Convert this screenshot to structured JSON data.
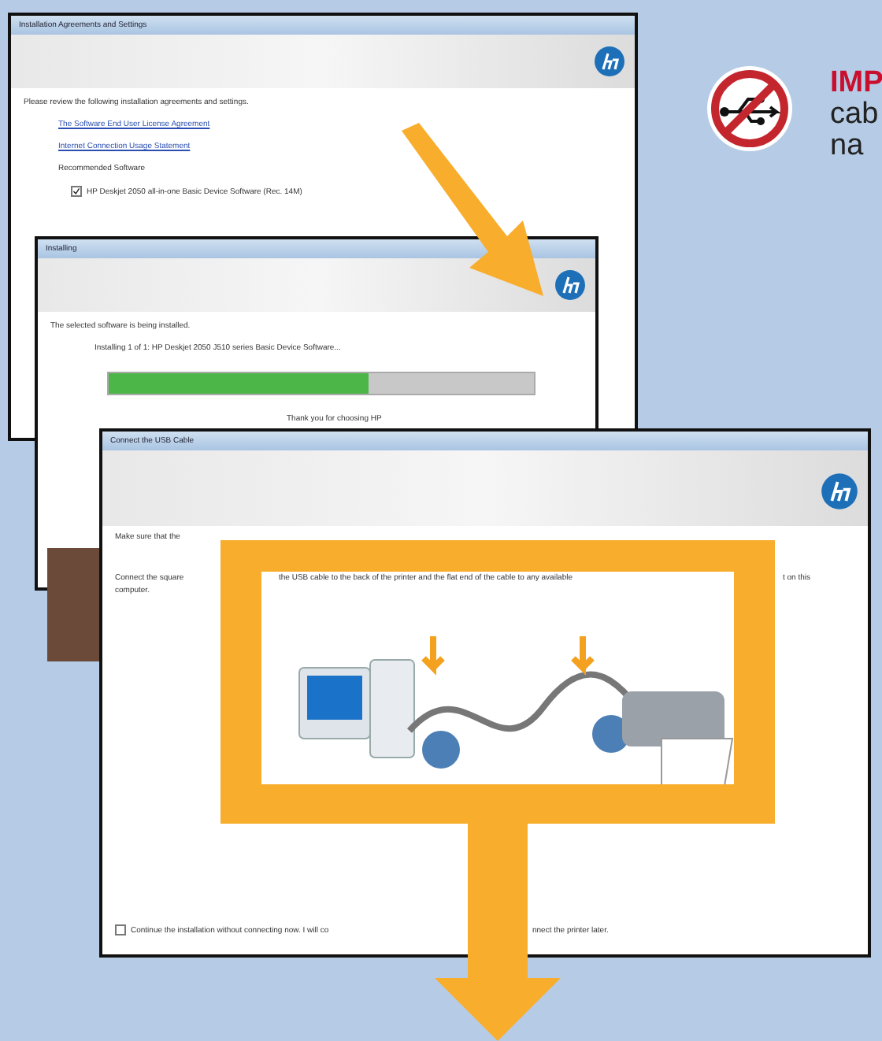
{
  "agreements_window": {
    "title": "Installation Agreements and Settings",
    "intro": "Please review the following installation agreements and settings.",
    "links": [
      "The Software End User License Agreement",
      "Internet Connection Usage Statement"
    ],
    "section": "Recommended Software",
    "software_item": {
      "label": "HP Deskjet 2050 all-in-one Basic Device Software (Rec. 14M)",
      "checked": true
    }
  },
  "installing_window": {
    "title": "Installing",
    "status": "The selected software is being installed.",
    "step": "Installing 1 of 1: HP Deskjet 2050 J510 series Basic Device Software...",
    "progress": {
      "level": 0.61
    },
    "thanks": "Thank you for choosing HP"
  },
  "usb_window": {
    "title": "Connect the USB Cable",
    "intro": "Make sure that the",
    "instruction_parts": [
      "Connect the square",
      "the USB cable to the back of the printer and the flat end of the cable to any available",
      "t on this",
      "computer."
    ],
    "option": {
      "checked": false,
      "label_parts": [
        "Continue the installation without connecting now. I will co",
        "nnect the printer later."
      ]
    }
  },
  "side_note": {
    "heading": "IMP",
    "lines": [
      "cab",
      "na"
    ]
  }
}
